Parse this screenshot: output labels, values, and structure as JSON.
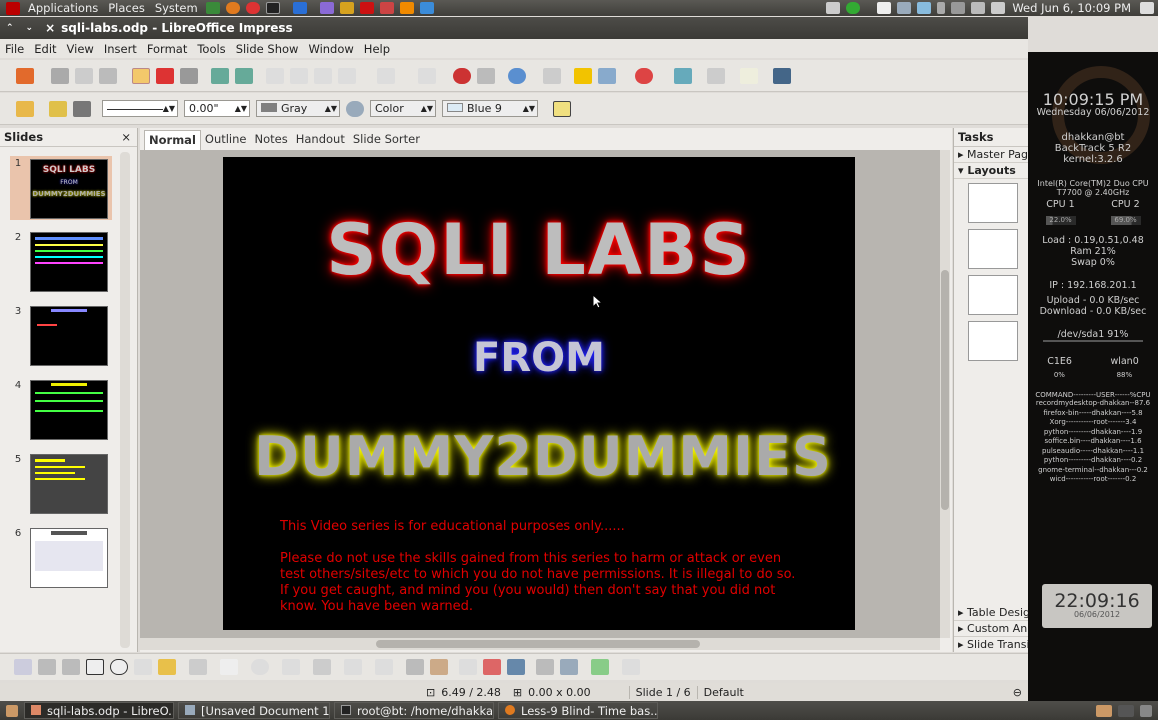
{
  "top_panel": {
    "menus": [
      "Applications",
      "Places",
      "System"
    ],
    "clock": "Wed Jun  6, 10:09 PM"
  },
  "window": {
    "title": "sqli-labs.odp - LibreOffice Impress"
  },
  "menubar": [
    "File",
    "Edit",
    "View",
    "Insert",
    "Format",
    "Tools",
    "Slide Show",
    "Window",
    "Help"
  ],
  "line_toolbar": {
    "line_width": "0.00\"",
    "line_color": "Gray",
    "area_style": "Color",
    "area_color": "Blue 9"
  },
  "slides_pane": {
    "title": "Slides",
    "close": "×",
    "thumbnails": [
      "1",
      "2",
      "3",
      "4",
      "5",
      "6"
    ]
  },
  "view_tabs": [
    "Normal",
    "Outline",
    "Notes",
    "Handout",
    "Slide Sorter"
  ],
  "slide": {
    "title": "SQLI LABS",
    "from": "FROM",
    "subtitle": "DUMMY2DUMMIES",
    "disclaimer1": "This Video series is for educational purposes only......",
    "disclaimer2": "Please do not use the skills gained from this series to harm or attack or even test others/sites/etc  to which you do not have permissions. It is illegal to do so. If you get caught, and mind you (you would) then don't say that you did not know. You have been warned."
  },
  "tasks_pane": {
    "title": "Tasks",
    "master_pages": "Master Pages",
    "layouts": "Layouts",
    "table_design": "Table Design",
    "custom_animation": "Custom Animation",
    "slide_transition": "Slide Transition"
  },
  "statusbar": {
    "position": "6.49 / 2.48",
    "size": "0.00 x 0.00",
    "slide": "Slide 1 / 6",
    "layout": "Default"
  },
  "taskbar": [
    "sqli-labs.odp - LibreO...",
    "[Unsaved Document 1...",
    "root@bt: /home/dhakkan",
    "Less-9 Blind- Time bas..."
  ],
  "conky": {
    "time": "10:09:15 PM",
    "date": "Wednesday 06/06/2012",
    "user": "dhakkan@bt",
    "distro": "BackTrack 5 R2",
    "kernel": "kernel:3.2.6",
    "cpu_model": "Intel(R) Core(TM)2 Duo CPU",
    "cpu_speed": "T7700  @ 2.40GHz",
    "cpu1_label": "CPU 1",
    "cpu2_label": "CPU 2",
    "cpu1_value": "22.0%",
    "cpu2_value": "69.0%",
    "load": "Load : 0.19,0.51,0.48",
    "ram": "Ram 21%",
    "swap": "Swap 0%",
    "ip": "IP : 192.168.201.1",
    "upload": "Upload - 0.0 KB/sec",
    "download": "Download - 0.0 KB/sec",
    "disk": "/dev/sda1 91%",
    "net1": "C1E6",
    "net2": "wlan0",
    "net1_val": "0%",
    "net2_val": "88%",
    "proc_header": "COMMAND---------USER------%CPU",
    "processes": [
      "recordmydesktop-dhakkan--87.6",
      "firefox-bin-----dhakkan----5.8",
      "Xorg-----------root-------3.4",
      "python---------dhakkan----1.9",
      "soffice.bin----dhakkan----1.6",
      "pulseaudio-----dhakkan----1.1",
      "python---------dhakkan----0.2",
      "gnome-terminal--dhakkan---0.2",
      "wicd-----------root-------0.2"
    ],
    "clock_big": "22:09:16",
    "clock_date": "06/06/2012"
  }
}
